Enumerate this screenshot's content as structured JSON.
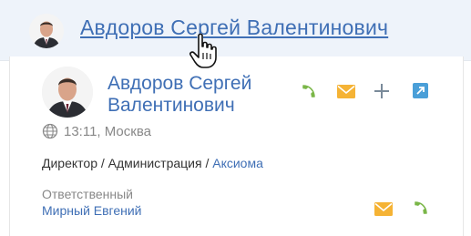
{
  "header": {
    "contact_name": "Авдоров Сергей Валентинович"
  },
  "card": {
    "name_line1": "Авдоров Сергей",
    "name_line2": "Валентинович",
    "time": "13:11, Москва",
    "job_prefix": "Директор / Администрация / ",
    "account": "Аксиома",
    "owner_label": "Ответственный",
    "owner_name": "Мирный Евгений"
  },
  "icons": {
    "phone": "phone-icon",
    "email": "envelope-icon",
    "add": "plus-icon",
    "open": "open-external-icon",
    "timezone": "globe-clock-icon",
    "cursor": "hand-pointer-icon"
  },
  "colors": {
    "link": "#3f6fb5",
    "phone": "#7ab648",
    "email": "#f5b335",
    "plus": "#7a8a9a",
    "open": "#4a9fd8",
    "muted": "#888888",
    "header_bg": "#eef3fa"
  }
}
